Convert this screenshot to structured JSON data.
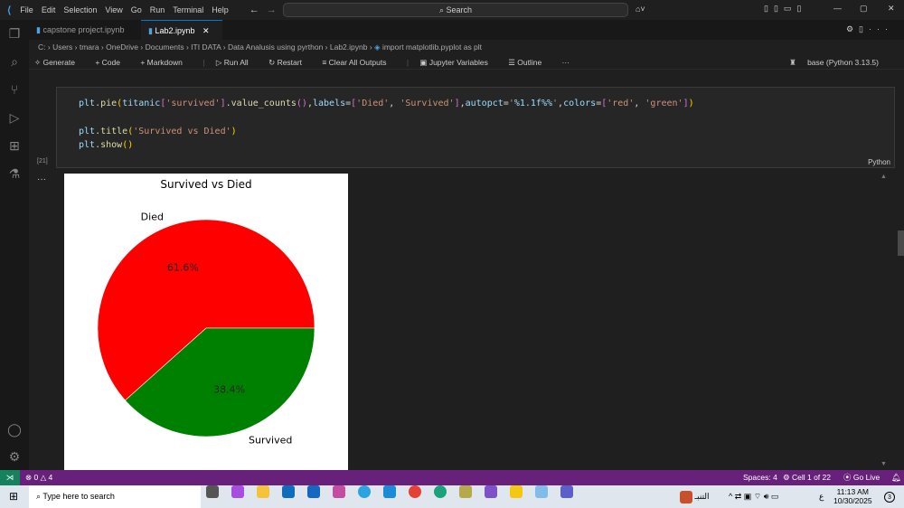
{
  "menu": [
    "File",
    "Edit",
    "Selection",
    "View",
    "Go",
    "Run",
    "Terminal",
    "Help"
  ],
  "search_placeholder": "Search",
  "tabs": [
    {
      "label": "capstone project.ipynb"
    },
    {
      "label": "Lab2.ipynb",
      "active": true
    }
  ],
  "breadcrumb": [
    "C:",
    "Users",
    "tmara",
    "OneDrive",
    "Documents",
    "ITI DATA",
    "Data Analusis using pyrthon",
    "Lab2.ipynb",
    "import matplotlib.pyplot as plt"
  ],
  "toolbar": {
    "generate": "Generate",
    "code": "Code",
    "markdown": "Markdown",
    "run_all": "Run All",
    "restart": "Restart",
    "clear": "Clear All Outputs",
    "variables": "Jupyter Variables",
    "outline": "Outline",
    "more": "···",
    "kernel": "base (Python 3.13.5)"
  },
  "cell": {
    "exec_count": "[21]",
    "language": "Python",
    "lines": [
      "plt.pie(titanic['survived'].value_counts(),labels=['Died', 'Survived'],autopct='%1.1f%%',colors=['red', 'green'])",
      "",
      "plt.title('Survived vs Died')",
      "plt.show()"
    ]
  },
  "output_prefix": "···",
  "chart_data": {
    "type": "pie",
    "title": "Survived vs Died",
    "labels": [
      "Died",
      "Survived"
    ],
    "values": [
      61.6,
      38.4
    ],
    "data_labels": [
      "61.6%",
      "38.4%"
    ],
    "colors": [
      "#ff0000",
      "#008000"
    ],
    "startangle": 0
  },
  "status": {
    "errors": "0",
    "warnings": "4",
    "spaces": "Spaces: 4",
    "cell": "Cell 1 of 22",
    "golive": "Go Live"
  },
  "taskbar": {
    "search": "Type here to search",
    "lang": "ع",
    "time": "11:13 AM",
    "date": "10/30/2025",
    "weather": "التنبـ",
    "notif": "3"
  }
}
